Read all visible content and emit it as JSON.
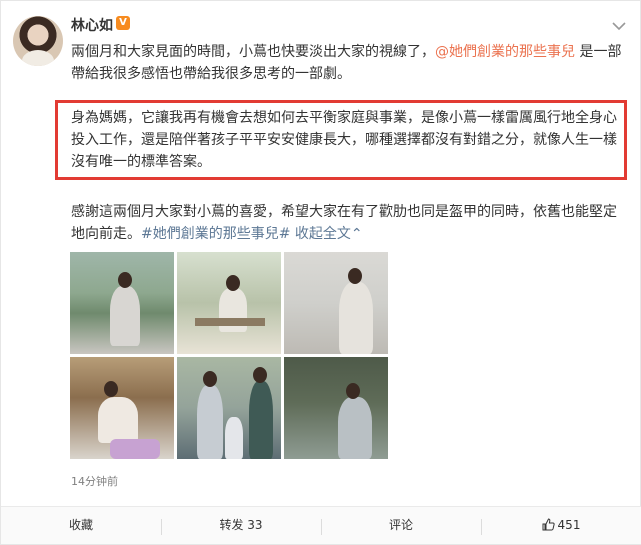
{
  "post": {
    "username": "林心如",
    "vip_badge": "V",
    "intro_text": "兩個月和大家見面的時間，小蔦也快要淡出大家的視線了，",
    "intro_mention": "@她們創業的那些事兒",
    "intro_text2": " 是一部帶給我很多感悟也帶給我很多思考的一部劇。",
    "highlight_text": "身為媽媽，它讓我再有機會去想如何去平衡家庭與事業，是像小蔦一樣雷厲風行地全身心投入工作，還是陪伴著孩子平平安安健康長大，哪種選擇都沒有對錯之分，就像人生一樣沒有唯一的標準答案。",
    "thanks_text": "感謝這兩個月大家對小蔦的喜愛，希望大家在有了歡肋也同是盔甲的同時，依舊也能堅定地向前走。",
    "hashtag": "#她們創業的那些事兒#",
    "collapse_link": " 收起全文",
    "collapse_arrow": "⌃",
    "timestamp": "14分钟前"
  },
  "actions": {
    "favorite": "收藏",
    "repost": "转发 33",
    "comment": "评论",
    "like": "451"
  },
  "colors": {
    "accent": "#eb7350",
    "highlight_border": "#e23b33",
    "link": "#5d7895"
  },
  "icons": {
    "more": "chevron-down-icon",
    "like": "thumbs-up-icon"
  }
}
